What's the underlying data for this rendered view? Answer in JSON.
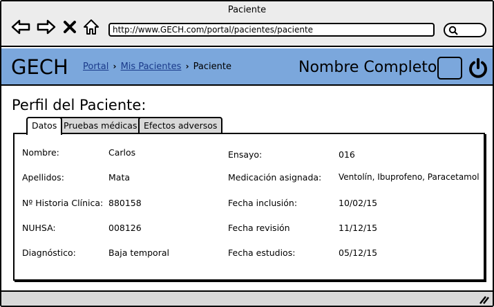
{
  "window": {
    "title": "Paciente"
  },
  "browser": {
    "url": "http://www.GECH.com/portal/pacientes/paciente",
    "icons": [
      "back-icon",
      "forward-icon",
      "stop-icon",
      "home-icon",
      "search-icon"
    ]
  },
  "header": {
    "brand": "GECH",
    "breadcrumb": [
      {
        "label": "Portal",
        "link": true
      },
      {
        "label": "Mis Pacientes",
        "link": true
      },
      {
        "label": "Paciente",
        "link": false
      }
    ],
    "user_name": "Nombre Completo",
    "accent": "#7ba7dc"
  },
  "main": {
    "title": "Perfil del Paciente:",
    "tabs": [
      {
        "label": "Datos",
        "active": true
      },
      {
        "label": "Pruebas médicas",
        "active": false
      },
      {
        "label": "Efectos adversos",
        "active": false
      }
    ],
    "left_fields": [
      {
        "label": "Nombre:",
        "value": "Carlos"
      },
      {
        "label": "Apellidos:",
        "value": "Mata"
      },
      {
        "label": "Nº Historia Clínica:",
        "value": "880158"
      },
      {
        "label": "NUHSA:",
        "value": "008126"
      },
      {
        "label": "Diagnóstico:",
        "value": "Baja temporal"
      }
    ],
    "right_fields": [
      {
        "label": "Ensayo:",
        "value": "016"
      },
      {
        "label": "Medicación asignada:",
        "value": "Ventolín, Ibuprofeno, Paracetamol"
      },
      {
        "label": "Fecha inclusión:",
        "value": "10/02/15"
      },
      {
        "label": "Fecha revisión",
        "value": "11/12/15"
      },
      {
        "label": "Fecha estudios:",
        "value": "05/12/15"
      }
    ]
  }
}
